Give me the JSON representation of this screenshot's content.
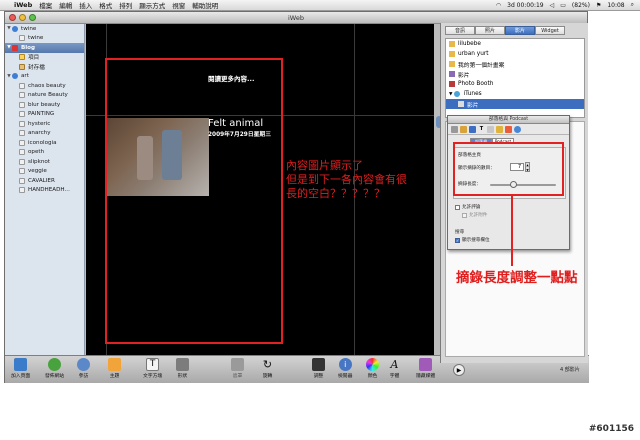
{
  "menubar": {
    "app_name": "iWeb",
    "items": [
      "檔案",
      "編輯",
      "插入",
      "格式",
      "排列",
      "顯示方式",
      "視窗",
      "輔助說明"
    ],
    "status_time_left": "3d 00:00:19",
    "battery": "(82%)",
    "clock": "10:08"
  },
  "window": {
    "title": "iWeb"
  },
  "sidebar": {
    "items": [
      {
        "label": "twine",
        "level": 0
      },
      {
        "label": "twine",
        "level": 1
      },
      {
        "label": "Blog",
        "level": 0
      },
      {
        "label": "項目",
        "level": 1
      },
      {
        "label": "封存檔",
        "level": 1
      },
      {
        "label": "art",
        "level": 0
      },
      {
        "label": "chaos beauty",
        "level": 1
      },
      {
        "label": "nature Beauty",
        "level": 1
      },
      {
        "label": "blur beauty",
        "level": 1
      },
      {
        "label": "PAINTING",
        "level": 1
      },
      {
        "label": "hysteric",
        "level": 1
      },
      {
        "label": "anarchy",
        "level": 1
      },
      {
        "label": "iconologia",
        "level": 1
      },
      {
        "label": "opeth",
        "level": 1
      },
      {
        "label": "slipknot",
        "level": 1
      },
      {
        "label": "veggie",
        "level": 1
      },
      {
        "label": "CAVALIER",
        "level": 1
      },
      {
        "label": "HANDHEADH...",
        "level": 1
      }
    ]
  },
  "canvas": {
    "read_more": "閱讀更多內容...",
    "post_title": "Felt animal",
    "post_date": "2009年7月29日星期三"
  },
  "annotations": {
    "left_note_lines": [
      "內容圖片顯示了",
      "但是到下一各內容會有很",
      "長的空白？？？？？"
    ],
    "right_note": "摘錄長度調整一點點"
  },
  "media": {
    "tabs": [
      "音訊",
      "照片",
      "影片",
      "Widget"
    ],
    "active_tab": "影片",
    "list": [
      "lilubebe",
      "urban yurt",
      "我的第一個計畫案",
      "影片",
      "Photo Booth",
      "iTunes",
      "影片"
    ]
  },
  "inspector": {
    "title": "部落格與 Podcast",
    "segments": [
      "部落格",
      "Podcast"
    ],
    "main_page_label": "部落格主頁",
    "excerpt_count_label": "顯示摘錄的數目：",
    "excerpt_count_value": "7",
    "excerpt_length_label": "摘錄長度：",
    "excerpt_length_level": 0.35,
    "allow_comments_label": "允許評論",
    "allow_attachments_label": "允許附件",
    "search_section_label": "搜尋",
    "show_search_label": "顯示搜尋欄位"
  },
  "bottombar": {
    "tools": [
      "加入頁面",
      "發佈網站",
      "參訪",
      "主題",
      "文字方塊",
      "形狀",
      "遮罩",
      "旋轉",
      "調整",
      "檢閱器",
      "顏色",
      "字體",
      "隱藏媒體"
    ],
    "item_count": "4 部影片"
  },
  "watermark": "#601156"
}
